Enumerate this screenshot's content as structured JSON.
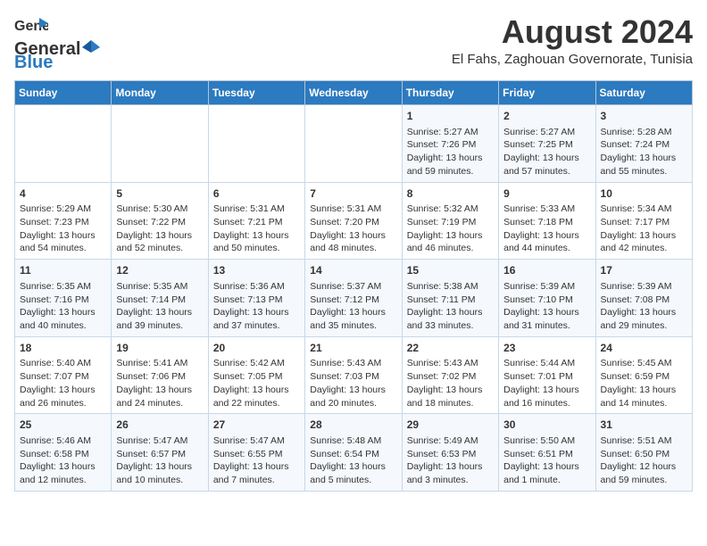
{
  "header": {
    "logo_line1": "General",
    "logo_line2": "Blue",
    "month": "August 2024",
    "location": "El Fahs, Zaghouan Governorate, Tunisia"
  },
  "days_of_week": [
    "Sunday",
    "Monday",
    "Tuesday",
    "Wednesday",
    "Thursday",
    "Friday",
    "Saturday"
  ],
  "weeks": [
    [
      {
        "day": "",
        "info": ""
      },
      {
        "day": "",
        "info": ""
      },
      {
        "day": "",
        "info": ""
      },
      {
        "day": "",
        "info": ""
      },
      {
        "day": "1",
        "info": "Sunrise: 5:27 AM\nSunset: 7:26 PM\nDaylight: 13 hours\nand 59 minutes."
      },
      {
        "day": "2",
        "info": "Sunrise: 5:27 AM\nSunset: 7:25 PM\nDaylight: 13 hours\nand 57 minutes."
      },
      {
        "day": "3",
        "info": "Sunrise: 5:28 AM\nSunset: 7:24 PM\nDaylight: 13 hours\nand 55 minutes."
      }
    ],
    [
      {
        "day": "4",
        "info": "Sunrise: 5:29 AM\nSunset: 7:23 PM\nDaylight: 13 hours\nand 54 minutes."
      },
      {
        "day": "5",
        "info": "Sunrise: 5:30 AM\nSunset: 7:22 PM\nDaylight: 13 hours\nand 52 minutes."
      },
      {
        "day": "6",
        "info": "Sunrise: 5:31 AM\nSunset: 7:21 PM\nDaylight: 13 hours\nand 50 minutes."
      },
      {
        "day": "7",
        "info": "Sunrise: 5:31 AM\nSunset: 7:20 PM\nDaylight: 13 hours\nand 48 minutes."
      },
      {
        "day": "8",
        "info": "Sunrise: 5:32 AM\nSunset: 7:19 PM\nDaylight: 13 hours\nand 46 minutes."
      },
      {
        "day": "9",
        "info": "Sunrise: 5:33 AM\nSunset: 7:18 PM\nDaylight: 13 hours\nand 44 minutes."
      },
      {
        "day": "10",
        "info": "Sunrise: 5:34 AM\nSunset: 7:17 PM\nDaylight: 13 hours\nand 42 minutes."
      }
    ],
    [
      {
        "day": "11",
        "info": "Sunrise: 5:35 AM\nSunset: 7:16 PM\nDaylight: 13 hours\nand 40 minutes."
      },
      {
        "day": "12",
        "info": "Sunrise: 5:35 AM\nSunset: 7:14 PM\nDaylight: 13 hours\nand 39 minutes."
      },
      {
        "day": "13",
        "info": "Sunrise: 5:36 AM\nSunset: 7:13 PM\nDaylight: 13 hours\nand 37 minutes."
      },
      {
        "day": "14",
        "info": "Sunrise: 5:37 AM\nSunset: 7:12 PM\nDaylight: 13 hours\nand 35 minutes."
      },
      {
        "day": "15",
        "info": "Sunrise: 5:38 AM\nSunset: 7:11 PM\nDaylight: 13 hours\nand 33 minutes."
      },
      {
        "day": "16",
        "info": "Sunrise: 5:39 AM\nSunset: 7:10 PM\nDaylight: 13 hours\nand 31 minutes."
      },
      {
        "day": "17",
        "info": "Sunrise: 5:39 AM\nSunset: 7:08 PM\nDaylight: 13 hours\nand 29 minutes."
      }
    ],
    [
      {
        "day": "18",
        "info": "Sunrise: 5:40 AM\nSunset: 7:07 PM\nDaylight: 13 hours\nand 26 minutes."
      },
      {
        "day": "19",
        "info": "Sunrise: 5:41 AM\nSunset: 7:06 PM\nDaylight: 13 hours\nand 24 minutes."
      },
      {
        "day": "20",
        "info": "Sunrise: 5:42 AM\nSunset: 7:05 PM\nDaylight: 13 hours\nand 22 minutes."
      },
      {
        "day": "21",
        "info": "Sunrise: 5:43 AM\nSunset: 7:03 PM\nDaylight: 13 hours\nand 20 minutes."
      },
      {
        "day": "22",
        "info": "Sunrise: 5:43 AM\nSunset: 7:02 PM\nDaylight: 13 hours\nand 18 minutes."
      },
      {
        "day": "23",
        "info": "Sunrise: 5:44 AM\nSunset: 7:01 PM\nDaylight: 13 hours\nand 16 minutes."
      },
      {
        "day": "24",
        "info": "Sunrise: 5:45 AM\nSunset: 6:59 PM\nDaylight: 13 hours\nand 14 minutes."
      }
    ],
    [
      {
        "day": "25",
        "info": "Sunrise: 5:46 AM\nSunset: 6:58 PM\nDaylight: 13 hours\nand 12 minutes."
      },
      {
        "day": "26",
        "info": "Sunrise: 5:47 AM\nSunset: 6:57 PM\nDaylight: 13 hours\nand 10 minutes."
      },
      {
        "day": "27",
        "info": "Sunrise: 5:47 AM\nSunset: 6:55 PM\nDaylight: 13 hours\nand 7 minutes."
      },
      {
        "day": "28",
        "info": "Sunrise: 5:48 AM\nSunset: 6:54 PM\nDaylight: 13 hours\nand 5 minutes."
      },
      {
        "day": "29",
        "info": "Sunrise: 5:49 AM\nSunset: 6:53 PM\nDaylight: 13 hours\nand 3 minutes."
      },
      {
        "day": "30",
        "info": "Sunrise: 5:50 AM\nSunset: 6:51 PM\nDaylight: 13 hours\nand 1 minute."
      },
      {
        "day": "31",
        "info": "Sunrise: 5:51 AM\nSunset: 6:50 PM\nDaylight: 12 hours\nand 59 minutes."
      }
    ]
  ]
}
